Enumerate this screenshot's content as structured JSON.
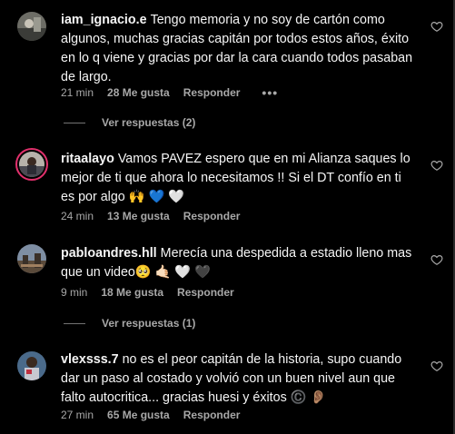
{
  "comments": [
    {
      "username": "iam_ignacio.e",
      "text": "Tengo memoria y no soy de cartón como algunos, muchas gracias capitán por todos estos años, éxito en lo q viene y gracias por dar la cara cuando todos pasaban de largo.",
      "time": "21 min",
      "likes": "28 Me gusta",
      "reply": "Responder",
      "more": "•••",
      "view_replies": "Ver respuestas (2)",
      "avatar": "avatar-photo"
    },
    {
      "username": "ritaalayo",
      "text": "Vamos PAVEZ espero que en mi Alianza saques lo mejor de ti que ahora lo necesitamos !! Si el DT confío en ti es por algo 🙌 💙 🤍",
      "time": "24 min",
      "likes": "13 Me gusta",
      "reply": "Responder",
      "avatar": "avatar-photo-story-ring"
    },
    {
      "username": "pabloandres.hll",
      "text": "Merecía una despedida a estadio lleno mas que un video🥺 🤙🏻 🤍 🖤",
      "time": "9 min",
      "likes": "18 Me gusta",
      "reply": "Responder",
      "view_replies": "Ver respuestas (1)",
      "avatar": "avatar-photo"
    },
    {
      "username": "vlexsss.7",
      "text": "no es el peor capitán de la historia, supo cuando dar un paso al costado y volvió con un buen nivel aun que falto autocritica... gracias huesi y éxitos ©️ 👂🏽",
      "time": "27 min",
      "likes": "65 Me gusta",
      "reply": "Responder",
      "avatar": "avatar-photo"
    }
  ],
  "icons": {
    "like": "heart-outline-icon",
    "more": "more-dots-icon"
  },
  "colors": {
    "background": "#000000",
    "text": "#f5f5f5",
    "secondary": "#a8a8a8",
    "story_ring": "#e1306c"
  }
}
